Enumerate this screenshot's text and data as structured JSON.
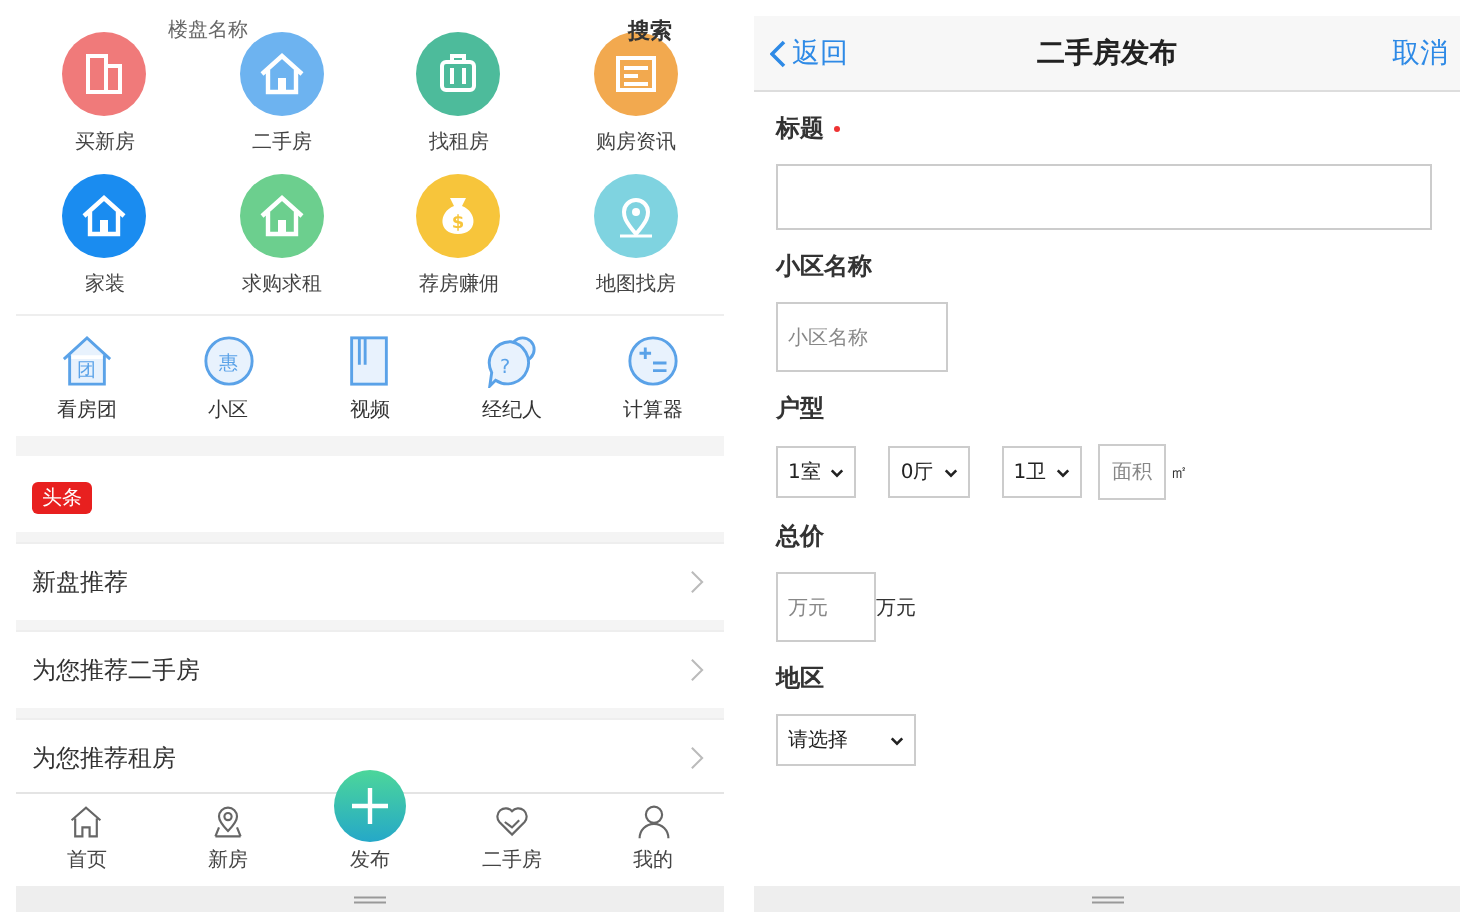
{
  "home": {
    "search": {
      "placeholder": "楼盘名称",
      "button": "搜索"
    },
    "grid": [
      {
        "label": "买新房",
        "color": "#f07a7a",
        "kind": "building"
      },
      {
        "label": "二手房",
        "color": "#6db3f0",
        "kind": "house"
      },
      {
        "label": "找租房",
        "color": "#4dbb9b",
        "kind": "case"
      },
      {
        "label": "购房资讯",
        "color": "#f2a94f",
        "kind": "doc"
      },
      {
        "label": "家装",
        "color": "#1a8cf0",
        "kind": "house"
      },
      {
        "label": "求购求租",
        "color": "#6ccf8e",
        "kind": "house"
      },
      {
        "label": "荐房赚佣",
        "color": "#f7c53b",
        "kind": "bag",
        "glyph": "$"
      },
      {
        "label": "地图找房",
        "color": "#7fd3e0",
        "kind": "pin"
      }
    ],
    "tools": [
      {
        "label": "看房团",
        "kind": "house",
        "glyph": "团"
      },
      {
        "label": "小区",
        "kind": "circle",
        "glyph": "惠"
      },
      {
        "label": "视频",
        "kind": "book"
      },
      {
        "label": "经纪人",
        "kind": "bubble",
        "glyph": "?"
      },
      {
        "label": "计算器",
        "kind": "calc"
      }
    ],
    "headline_badge": "头条",
    "sections": [
      "新盘推荐",
      "为您推荐二手房",
      "为您推荐租房"
    ],
    "tabbar": [
      {
        "label": "首页",
        "kind": "home"
      },
      {
        "label": "新房",
        "kind": "pin"
      },
      {
        "label": "发布",
        "kind": "plus"
      },
      {
        "label": "二手房",
        "kind": "heart"
      },
      {
        "label": "我的",
        "kind": "person"
      }
    ]
  },
  "publish": {
    "back": "返回",
    "title": "二手房发布",
    "cancel": "取消",
    "fields": [
      {
        "kind": "text",
        "label": "标题",
        "required": true
      },
      {
        "kind": "short",
        "label": "小区名称",
        "placeholder": "小区名称"
      },
      {
        "kind": "layout",
        "label": "户型",
        "selects": [
          "1室",
          "0厅",
          "1卫"
        ],
        "placeholder": "面积",
        "unit": "㎡"
      },
      {
        "kind": "short",
        "label": "总价",
        "placeholder": "万元",
        "unit": "万元"
      },
      {
        "kind": "select",
        "label": "地区",
        "value": "请选择"
      }
    ]
  }
}
